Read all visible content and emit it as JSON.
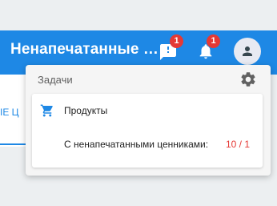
{
  "appbar": {
    "title": "Ненапечатанные …",
    "messages_badge": "1",
    "notifications_badge": "1"
  },
  "subbar": {
    "tab_label": "ІЕ Ц"
  },
  "panel": {
    "title": "Задачи",
    "card": {
      "title": "Продукты",
      "stat_label": "С ненапечатанными ценниками:",
      "stat_value": "10 / 1"
    }
  },
  "icons": {
    "messages": "message-alert-icon",
    "notifications": "bell-icon",
    "account": "account-icon",
    "settings": "gear-icon",
    "cart": "cart-icon"
  },
  "colors": {
    "primary": "#1e88e5",
    "badge": "#e53935",
    "accent_value": "#e53935"
  }
}
